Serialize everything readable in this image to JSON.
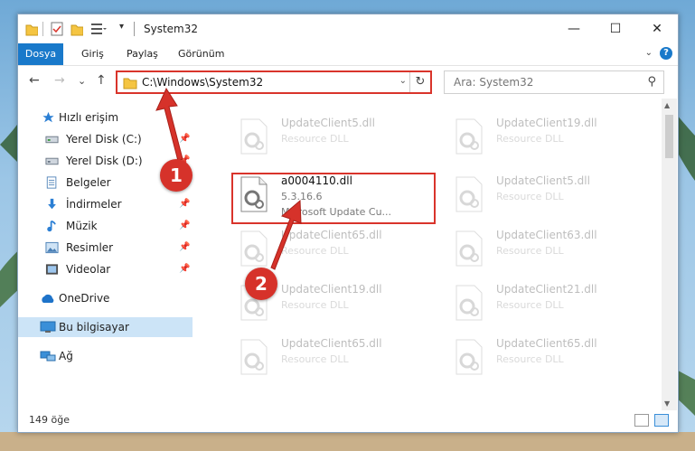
{
  "window": {
    "title": "System32",
    "controls": {
      "minimize": "—",
      "maximize": "☐",
      "close": "✕"
    }
  },
  "ribbon": {
    "tabs": [
      "Dosya",
      "Giriş",
      "Paylaş",
      "Görünüm"
    ],
    "help": "?"
  },
  "navigation": {
    "back": "←",
    "forward": "→",
    "recent": "⌄",
    "up": "↑",
    "address": "C:\\Windows\\System32",
    "search_placeholder": "Ara: System32"
  },
  "sidebar": {
    "items": [
      {
        "label": "Hızlı erişim",
        "icon": "star-icon",
        "pinned": false
      },
      {
        "label": "Yerel Disk (C:)",
        "icon": "drive-icon",
        "pinned": true
      },
      {
        "label": "Yerel Disk (D:)",
        "icon": "drive-icon",
        "pinned": true
      },
      {
        "label": "Belgeler",
        "icon": "documents-icon",
        "pinned": true
      },
      {
        "label": "İndirmeler",
        "icon": "download-icon",
        "pinned": true
      },
      {
        "label": "Müzik",
        "icon": "music-icon",
        "pinned": true
      },
      {
        "label": "Resimler",
        "icon": "pictures-icon",
        "pinned": true
      },
      {
        "label": "Videolar",
        "icon": "videos-icon",
        "pinned": true
      },
      {
        "label": "OneDrive",
        "icon": "cloud-icon",
        "pinned": false
      },
      {
        "label": "Bu bilgisayar",
        "icon": "computer-icon",
        "pinned": false,
        "selected": true
      },
      {
        "label": "Ağ",
        "icon": "network-icon",
        "pinned": false
      }
    ]
  },
  "files": [
    {
      "name": "UpdateClient5.dll",
      "type": "Resource DLL",
      "faded": true
    },
    {
      "name": "UpdateClient19.dll",
      "type": "Resource DLL",
      "faded": true
    },
    {
      "name": "a0004110.dll",
      "version": "5.3.16.6",
      "type": "Microsoft Update Cu...",
      "faded": false,
      "highlighted": true
    },
    {
      "name": "UpdateClient5.dll",
      "type": "Resource DLL",
      "faded": true
    },
    {
      "name": "UpdateClient65.dll",
      "type": "Resource DLL",
      "faded": true
    },
    {
      "name": "UpdateClient63.dll",
      "type": "Resource DLL",
      "faded": true
    },
    {
      "name": "UpdateClient19.dll",
      "type": "Resource DLL",
      "faded": true
    },
    {
      "name": "UpdateClient21.dll",
      "type": "Resource DLL",
      "faded": true
    },
    {
      "name": "UpdateClient65.dll",
      "type": "Resource DLL",
      "faded": true
    },
    {
      "name": "UpdateClient65.dll",
      "type": "Resource DLL",
      "faded": true
    }
  ],
  "status": {
    "count": "149 öğe"
  },
  "annotations": {
    "step1": "1",
    "step2": "2"
  },
  "colors": {
    "accent": "#1979ca",
    "highlight": "#d9342b",
    "selected": "#cce4f7"
  }
}
